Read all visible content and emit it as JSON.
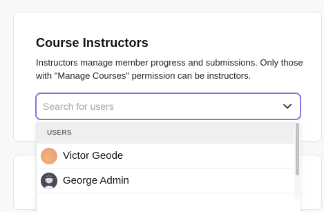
{
  "section": {
    "title": "Course Instructors",
    "description": "Instructors manage member progress and submissions. Only those with \"Manage Courses\" permission can be instructors."
  },
  "search": {
    "placeholder": "Search for users",
    "value": "",
    "icon": "chevron-down-icon"
  },
  "dropdown": {
    "group_label": "USERS",
    "options": [
      {
        "name": "Victor Geode",
        "avatar": "gradient-avatar"
      },
      {
        "name": "George Admin",
        "avatar": "photo-avatar"
      }
    ]
  },
  "colors": {
    "focus_border": "#8b6fe0",
    "group_bg": "#efefef",
    "page_bg": "#f8f8f8"
  }
}
